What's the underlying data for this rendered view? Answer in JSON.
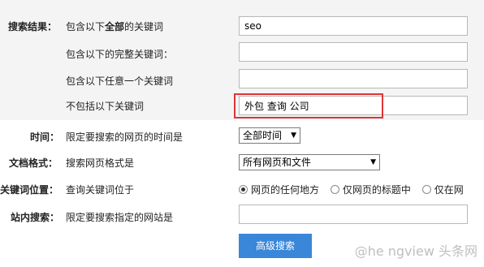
{
  "search_result": {
    "title": "搜索结果：",
    "rows": [
      {
        "label_prefix": "包含以下",
        "label_bold": "全部",
        "label_suffix": "的关键词",
        "value": "seo"
      },
      {
        "label": "包含以下的完整关键词：",
        "value": ""
      },
      {
        "label": "包含以下任意一个关键词",
        "value": ""
      },
      {
        "label": "不包括以下关键词",
        "value": "外包 查询 公司"
      }
    ]
  },
  "time": {
    "title": "时间：",
    "label": "限定要搜索的网页的时间是",
    "selected": "全部时间"
  },
  "format": {
    "title": "文档格式：",
    "label": "搜索网页格式是",
    "selected": "所有网页和文件"
  },
  "keyword_position": {
    "title": "关键词位置：",
    "label": "查询关键词位于",
    "options": [
      "网页的任何地方",
      "仅网页的标题中",
      "仅在网"
    ],
    "checked_index": 0
  },
  "site_search": {
    "title": "站内搜索：",
    "label": "限定要搜索指定的网站是",
    "value": ""
  },
  "submit_label": "高级搜索",
  "watermark": "@he ngview 头条网",
  "accent_color": "#3a86d9",
  "highlight_color": "#e0343a"
}
